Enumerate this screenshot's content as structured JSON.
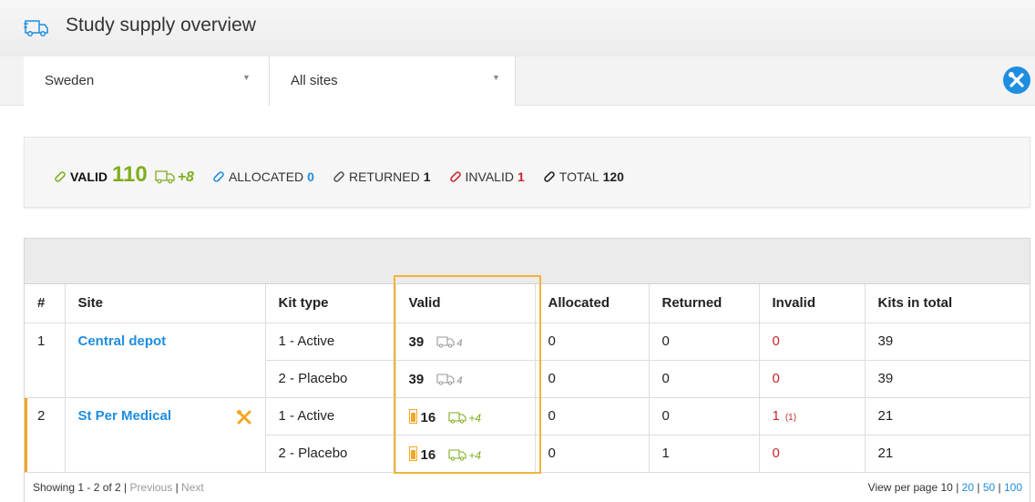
{
  "header": {
    "title": "Study supply overview"
  },
  "filters": {
    "country": "Sweden",
    "site": "All sites"
  },
  "summary": {
    "valid_label": "VALID",
    "valid_value": "110",
    "in_transit": "+8",
    "allocated_label": "ALLOCATED",
    "allocated_value": "0",
    "returned_label": "RETURNED",
    "returned_value": "1",
    "invalid_label": "INVALID",
    "invalid_value": "1",
    "total_label": "TOTAL",
    "total_value": "120"
  },
  "table": {
    "columns": [
      "#",
      "Site",
      "Kit type",
      "Valid",
      "Allocated",
      "Returned",
      "Invalid",
      "Kits in total"
    ],
    "rows": [
      {
        "num": "1",
        "site": "Central depot",
        "kit": "1 - Active",
        "valid": "39",
        "transit": "4",
        "allocated": "0",
        "returned": "0",
        "invalid": "0",
        "total": "39"
      },
      {
        "kit": "2 - Placebo",
        "valid": "39",
        "transit": "4",
        "allocated": "0",
        "returned": "0",
        "invalid": "0",
        "total": "39"
      },
      {
        "num": "2",
        "site": "St Per Medical",
        "kit": "1 - Active",
        "valid": "16",
        "transit": "+4",
        "allocated": "0",
        "returned": "0",
        "invalid": "1",
        "invalid_sub": "(1)",
        "total": "21"
      },
      {
        "kit": "2 - Placebo",
        "valid": "16",
        "transit": "+4",
        "allocated": "0",
        "returned": "1",
        "invalid": "0",
        "total": "21"
      }
    ]
  },
  "footer": {
    "showing": "Showing 1 - 2 of 2 |",
    "previous": "Previous",
    "sep": "|",
    "next": "Next",
    "view_per_page": "View per page",
    "pp10": "10",
    "pp20": "20",
    "pp50": "50",
    "pp100": "100"
  },
  "colors": {
    "accent_blue": "#1f8de0",
    "valid_green": "#7fae1e",
    "invalid_red": "#c8272d",
    "warning_orange": "#f5a623"
  }
}
